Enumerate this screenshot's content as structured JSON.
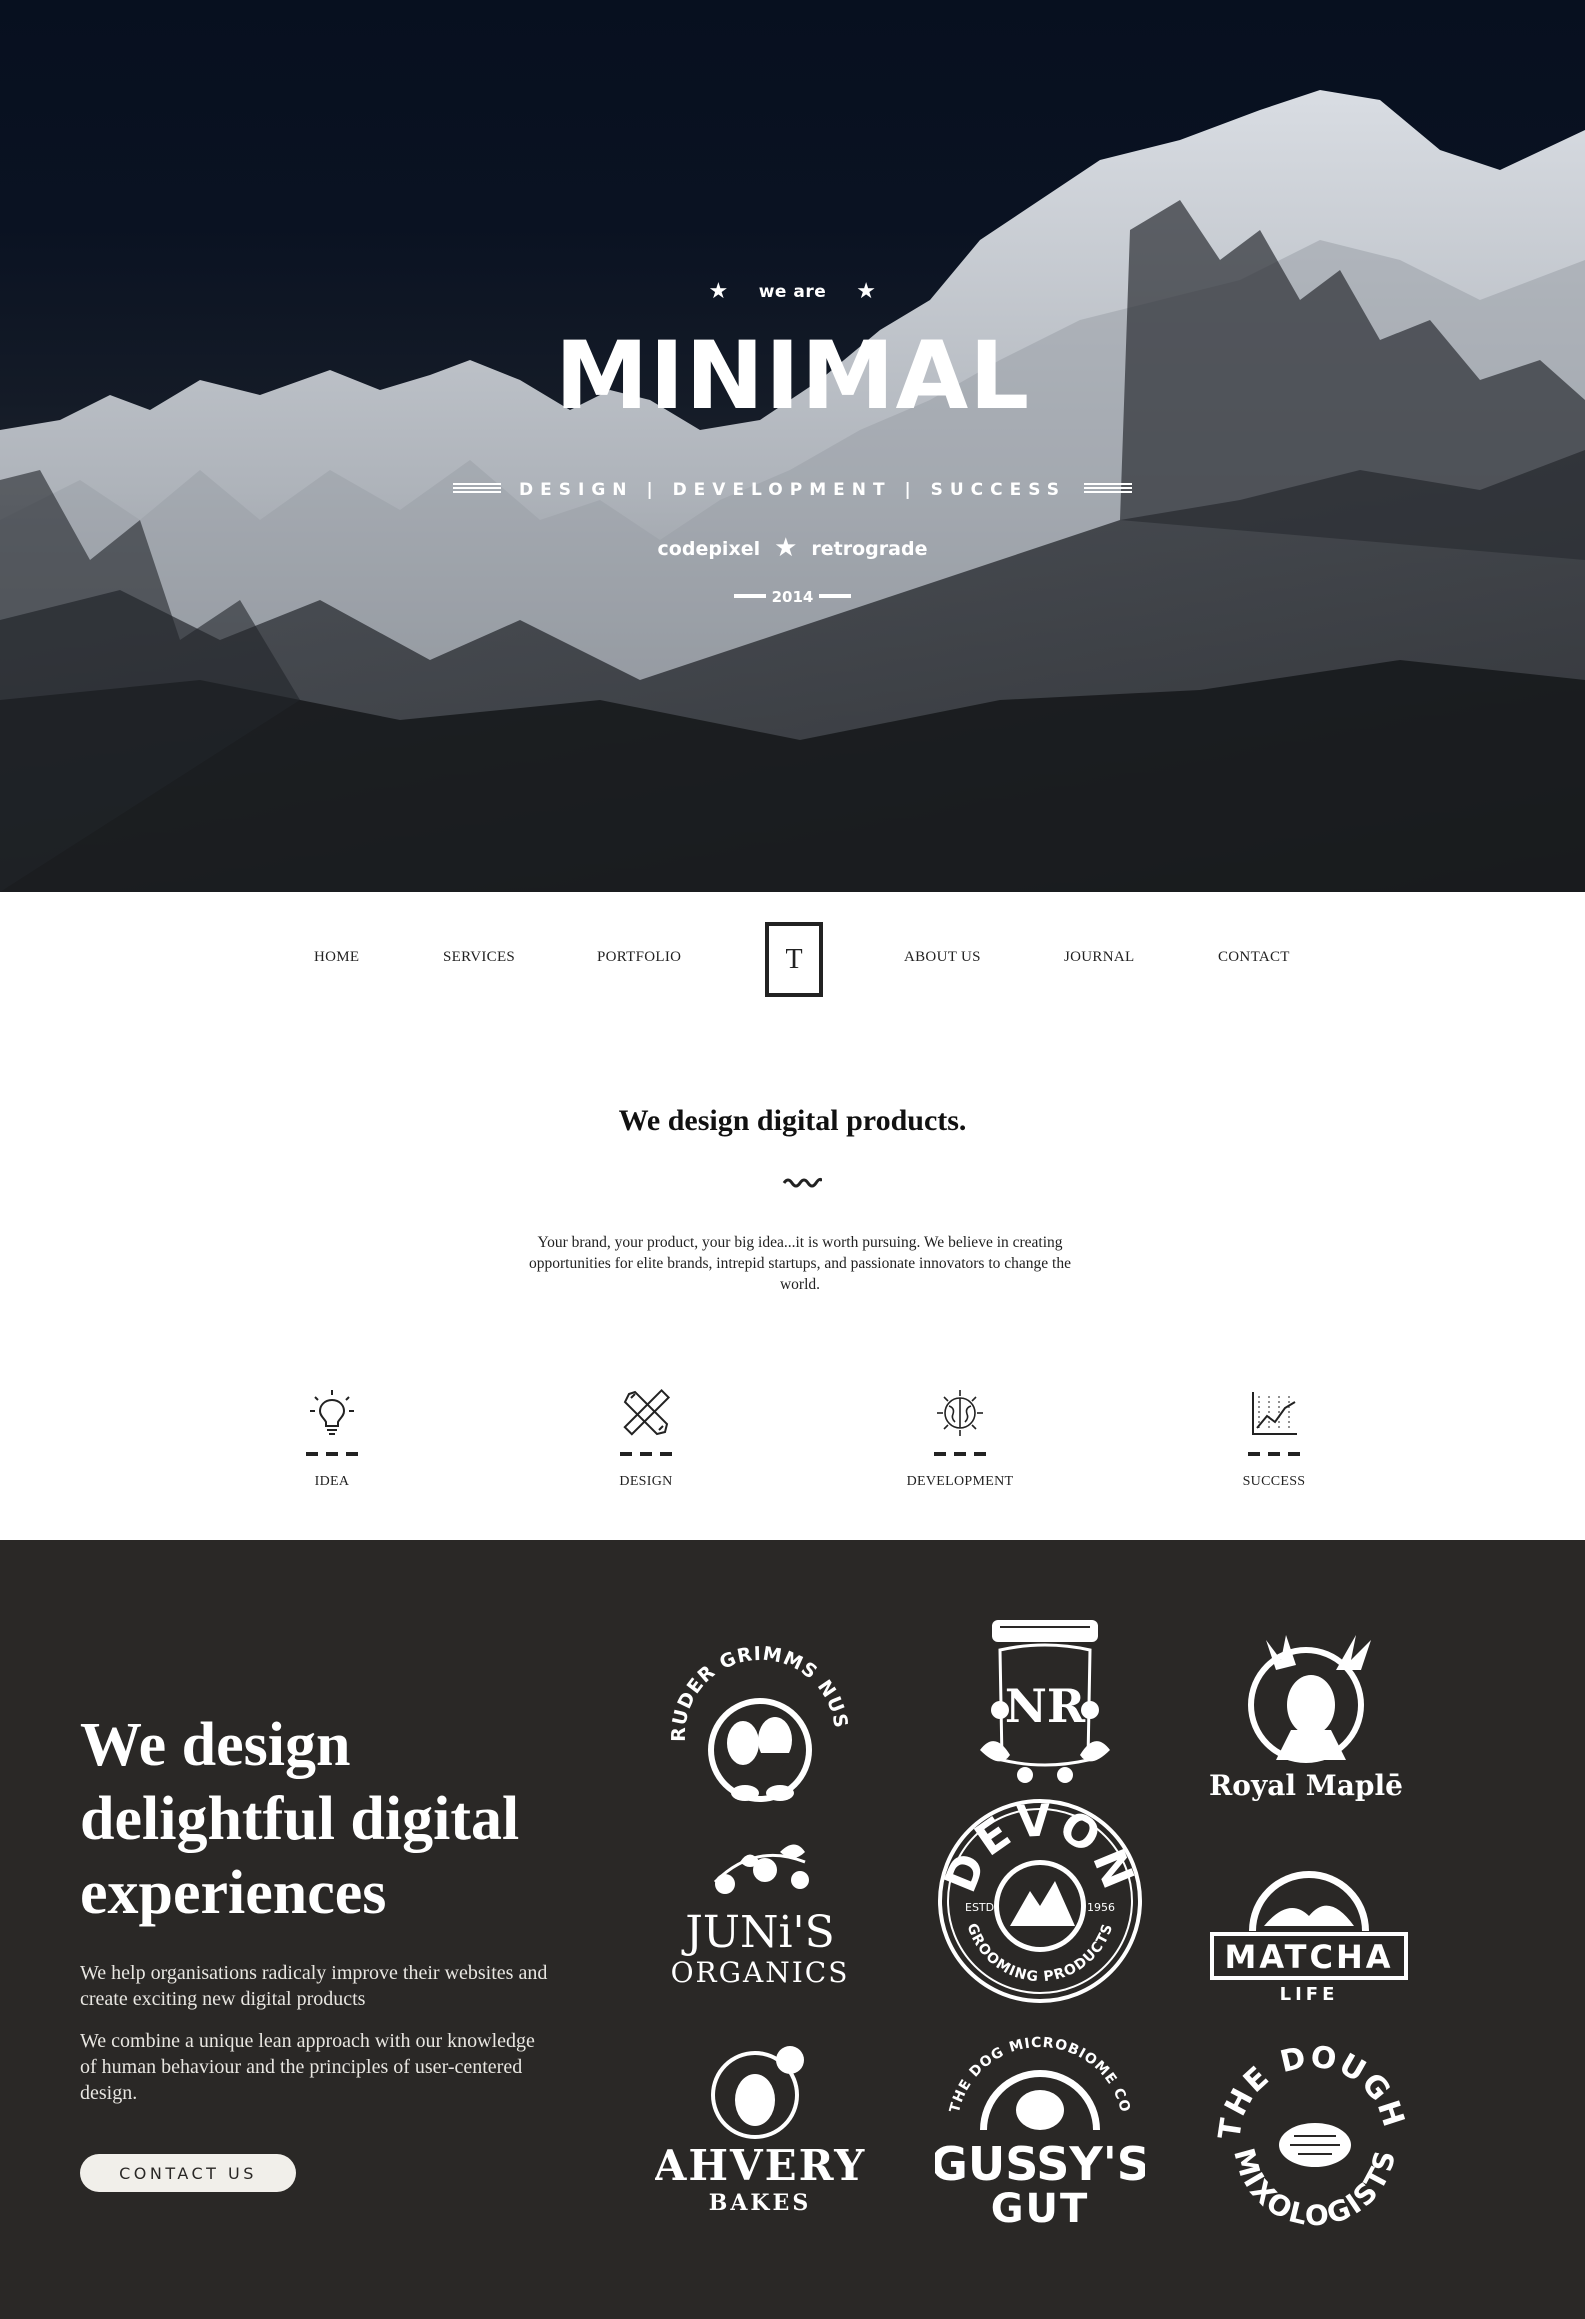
{
  "hero": {
    "pre_title": "we are",
    "title": "MINIMAL",
    "tagline": "DESIGN | DEVELOPMENT | SUCCESS",
    "name_left": "codepixel",
    "name_right": "retrograde",
    "year": "2014"
  },
  "nav": {
    "items": [
      "HOME",
      "SERVICES",
      "PORTFOLIO",
      "ABOUT US",
      "JOURNAL",
      "CONTACT"
    ],
    "logo": "T"
  },
  "intro": {
    "title": "We design digital products.",
    "text": "Your brand, your product, your big idea...it is worth pursuing. We believe in creating opportunities for elite brands, intrepid startups, and passionate innovators to change the world."
  },
  "features": [
    {
      "label": "IDEA",
      "icon": "lightbulb-icon"
    },
    {
      "label": "DESIGN",
      "icon": "pencil-ruler-icon"
    },
    {
      "label": "DEVELOPMENT",
      "icon": "brain-icon"
    },
    {
      "label": "SUCCESS",
      "icon": "chart-icon"
    }
  ],
  "showcase": {
    "heading": "We design delightful digital experiences",
    "para1": "We help organisations radicaly improve their websites and create exciting new digital products",
    "para2": "We combine a unique lean approach with our knowledge of human behaviour and the principles of user-centered design.",
    "button": "CONTACT US",
    "brands": [
      "BRUDER GRIMMS NUSSE",
      "NR",
      "Royal Maplē",
      "JUNi'S",
      "ORGANICS",
      "DEVON",
      "ESTD",
      "1956",
      "GROOMING PRODUCTS",
      "MATCHA",
      "LIFE",
      "AHVERY",
      "BAKES",
      "THE DOG MICROBIOME CO",
      "GUSSY'S",
      "GUT",
      "THE DOUGH",
      "MIXOLOGISTS"
    ]
  },
  "colors": {
    "dark_bg": "#2a2826",
    "hero_sky": "#07101f",
    "text": "#222222"
  }
}
